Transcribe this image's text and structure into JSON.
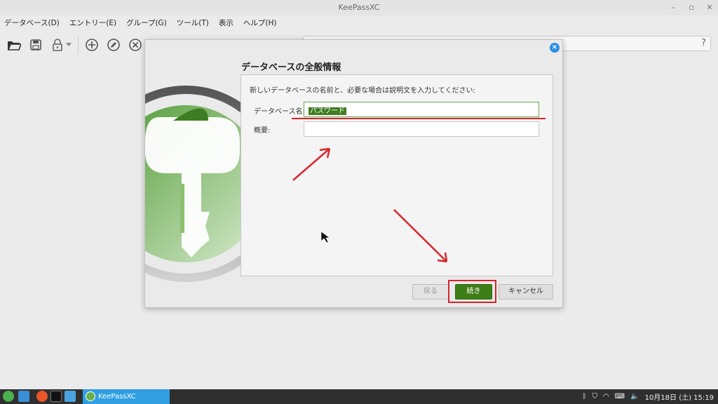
{
  "window": {
    "title": "KeePassXC"
  },
  "menu": [
    "データベース(D)",
    "エントリー(E)",
    "グループ(G)",
    "ツール(T)",
    "表示",
    "ヘルプ(H)"
  ],
  "toolbar": {
    "search_help": "?"
  },
  "dialog": {
    "title": "データベースの全般情報",
    "description": "新しいデータベースの名前と、必要な場合は説明文を入力してください:",
    "name_label": "データベース名:",
    "name_value": "パスワード",
    "desc_label": "概要:",
    "desc_value": "",
    "back_label": "戻る",
    "next_label": "続き",
    "cancel_label": "キャンセル"
  },
  "taskbar": {
    "active_app": "KeePassXC",
    "clock": "10月18日 (土) 15:19"
  },
  "colors": {
    "accent_green": "#3e7e17",
    "annotation_red": "#d8232a",
    "taskbar_active": "#2f9fe2"
  }
}
